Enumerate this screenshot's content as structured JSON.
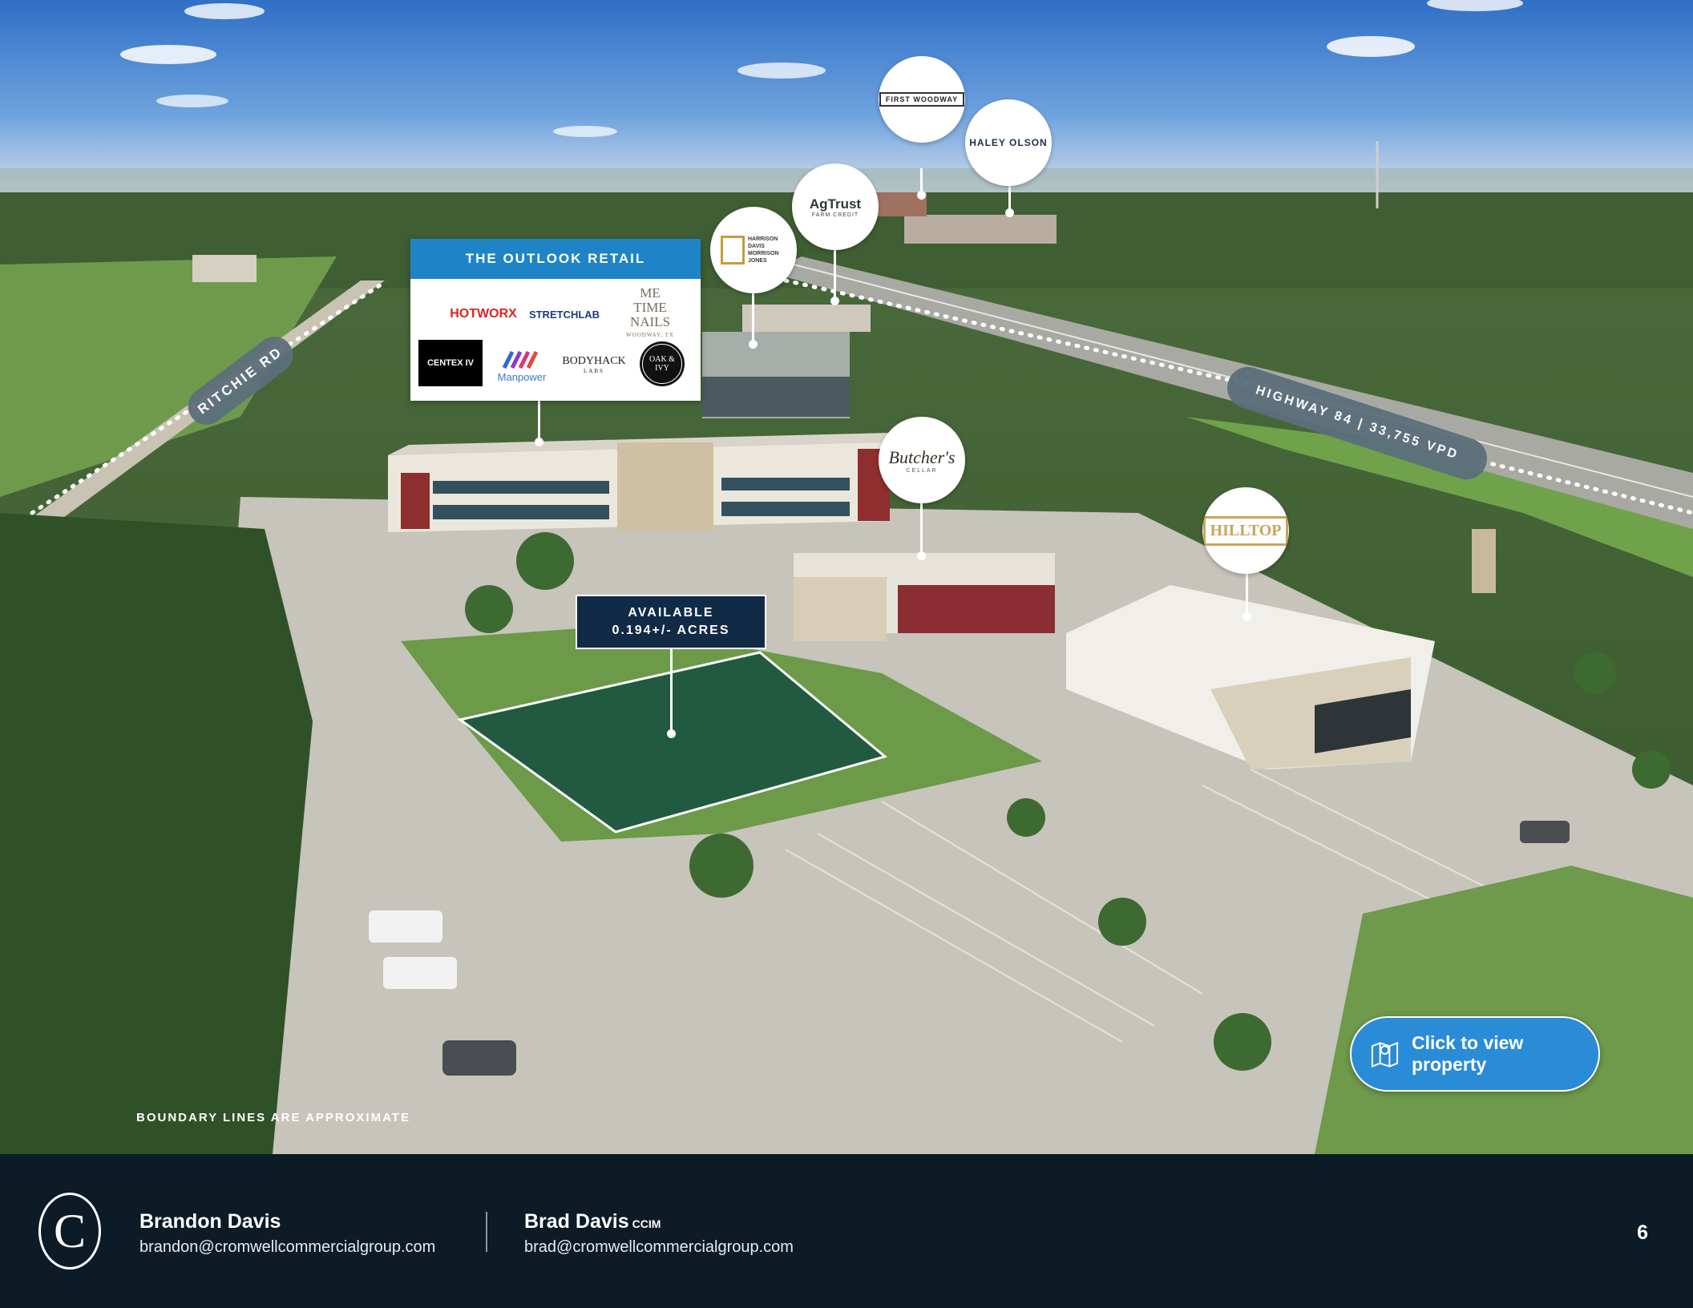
{
  "outlook": {
    "title": "THE OUTLOOK RETAIL",
    "tenants": {
      "hotworx": "HOTWORX",
      "stretchlab": "STRETCHLAB",
      "metime": "ME TIME NAILS",
      "metime_loc": "WOODWAY, TX",
      "centex": "CENTEX IV",
      "manpower": "Manpower",
      "bodyhack": "BODYHACK",
      "bodyhack_sub": "LABS",
      "oakivy": "OAK & IVY"
    }
  },
  "neighbors": {
    "first_woodway": "FIRST WOODWAY",
    "haley_olson": "HALEY OLSON",
    "agtrust": "AgTrust",
    "agtrust_sub": "FARM CREDIT",
    "harrison": "HARRISON DAVIS MORRISON JONES",
    "butchers": "Butcher's",
    "butchers_sub": "CELLAR",
    "hilltop": "HILLTOP"
  },
  "available": {
    "line1": "AVAILABLE",
    "line2": "0.194+/- ACRES"
  },
  "roads": {
    "ritchie": "RITCHIE RD",
    "highway": "HIGHWAY 84 | 33,755 VPD"
  },
  "boundary_note": "BOUNDARY LINES ARE APPROXIMATE",
  "view_button": "Click to view property",
  "footer": {
    "agent1_name": "Brandon Davis",
    "agent1_email": "brandon@cromwellcommercialgroup.com",
    "agent2_name": "Brad Davis",
    "agent2_cred": "CCIM",
    "agent2_email": "brad@cromwellcommercialgroup.com",
    "page_number": "6",
    "brand_letter": "C"
  },
  "colors": {
    "accent_blue": "#1f84c7",
    "navy": "#112a46",
    "footer_bg": "#0d1b26",
    "button_blue": "#2a8bd6"
  }
}
